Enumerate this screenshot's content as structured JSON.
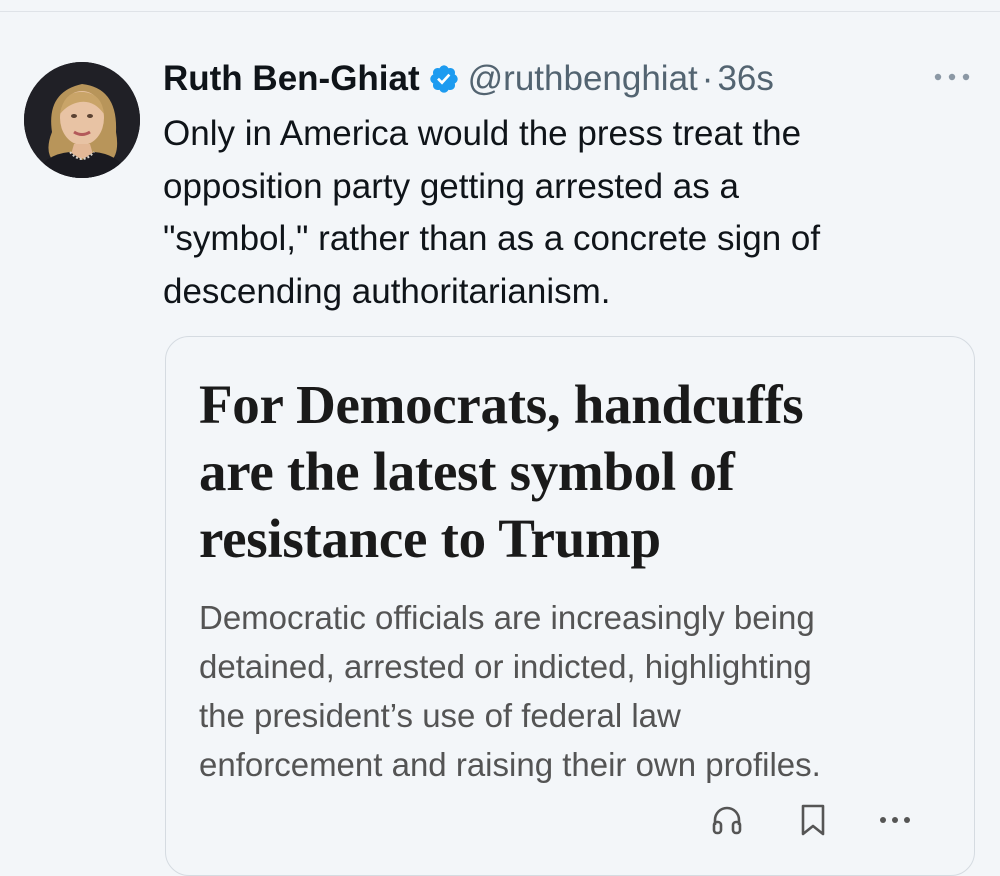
{
  "tweet": {
    "author_name": "Ruth Ben-Ghiat",
    "handle": "@ruthbenghiat",
    "separator": "·",
    "time": "36s",
    "text_lines": [
      "Only in America would the press treat the",
      "opposition party getting arrested as a",
      "\"symbol,\" rather than as a concrete sign of",
      "descending authoritarianism."
    ],
    "icons": {
      "avatar": "profile-photo",
      "verified": "verified-badge-icon",
      "more": "more-horizontal-icon"
    }
  },
  "card": {
    "headline_lines": [
      "For Democrats, handcuffs",
      "are the latest symbol of",
      "resistance to Trump"
    ],
    "summary_lines": [
      "Democratic officials are increasingly being",
      "detained, arrested or indicted, highlighting",
      "the president’s use of federal law",
      "enforcement and raising their own profiles."
    ],
    "actions": [
      "headphones-icon",
      "bookmark-icon",
      "more-horizontal-icon"
    ]
  },
  "colors": {
    "background": "#f3f6f9",
    "text_primary": "#0f1419",
    "text_secondary": "#536471",
    "verified_blue": "#1d9bf0",
    "card_border": "#d5dbe1",
    "summary_text": "#545454"
  }
}
